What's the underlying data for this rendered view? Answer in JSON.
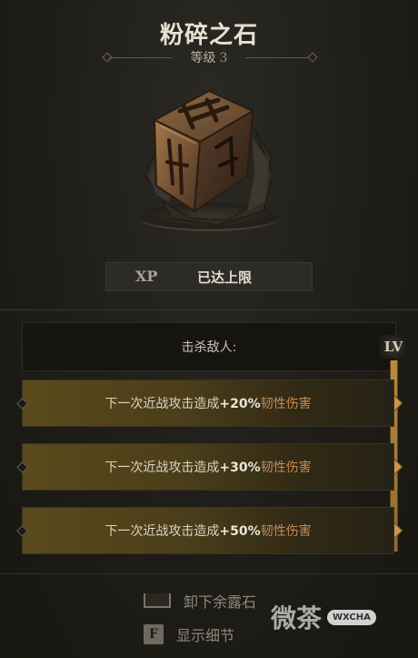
{
  "item": {
    "name": "粉碎之石",
    "level_label": "等级",
    "level_value": "3"
  },
  "xp": {
    "label": "XP",
    "status": "已达上限"
  },
  "condition": {
    "text": "击杀敌人:"
  },
  "level_track": {
    "badge": "LV"
  },
  "tiers": [
    {
      "prefix": "下一次近战攻击造成",
      "value": "+20%",
      "keyword": "韧性伤害"
    },
    {
      "prefix": "下一次近战攻击造成",
      "value": "+30%",
      "keyword": "韧性伤害"
    },
    {
      "prefix": "下一次近战攻击造成",
      "value": "+50%",
      "keyword": "韧性伤害"
    }
  ],
  "actions": [
    {
      "key": "",
      "key_icon": "spacebar-icon",
      "label": "卸下余露石"
    },
    {
      "key": "F",
      "key_icon": "f-key-icon",
      "label": "显示细节"
    }
  ],
  "watermark": {
    "text": "微茶",
    "badge": "WXCHA"
  },
  "colors": {
    "keyword": "#c58b55",
    "track": "#b88a3c",
    "row_gold": "#5a4a1c"
  }
}
